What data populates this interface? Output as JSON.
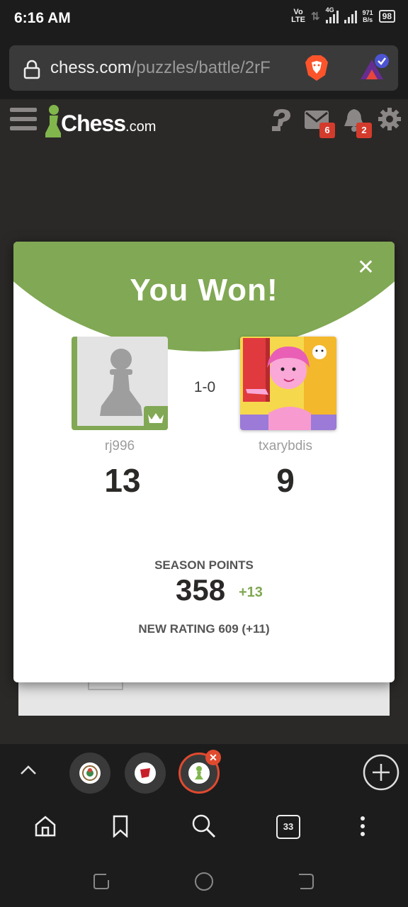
{
  "status_bar": {
    "time": "6:16 AM",
    "volte_top": "Vo",
    "volte_bottom": "LTE",
    "network": "4G",
    "speed_value": "971",
    "speed_unit": "B/s",
    "battery": "98"
  },
  "browser": {
    "url_host": "chess.com",
    "url_path": "/puzzles/battle/2rF"
  },
  "site": {
    "logo_main": "Chess",
    "logo_suffix": ".com",
    "messages_count": "6",
    "notifications_count": "2"
  },
  "modal": {
    "title": "You Won!",
    "result": "1-0",
    "player_left": {
      "name": "rj996",
      "score": "13"
    },
    "player_right": {
      "name": "txarybdis",
      "score": "9"
    },
    "season_points_label": "SEASON POINTS",
    "season_points_value": "358",
    "season_points_delta": "+13",
    "new_rating": "NEW RATING 609 (+11)"
  },
  "tabs": {
    "count": "33"
  },
  "colors": {
    "accent_green": "#81a854",
    "badge_red": "#d33b2c",
    "tab_active_ring": "#e04a2f",
    "brave_orange": "#fb542b"
  }
}
